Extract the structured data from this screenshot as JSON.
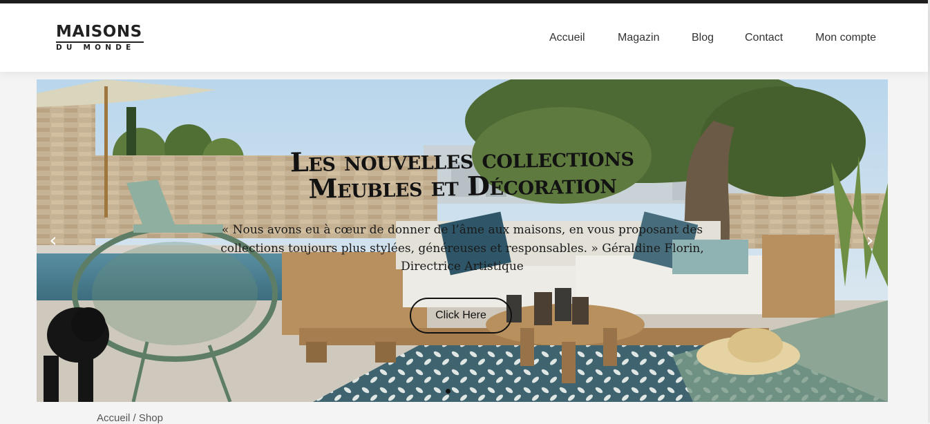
{
  "brand": {
    "name_top": "MAISONS",
    "name_bottom": "DU MONDE"
  },
  "nav": {
    "items": [
      {
        "label": "Accueil"
      },
      {
        "label": "Magazin"
      },
      {
        "label": "Blog"
      },
      {
        "label": "Contact"
      },
      {
        "label": "Mon compte"
      }
    ]
  },
  "hero": {
    "title_line1": "Les nouvelles collections",
    "title_line2": "Meubles et Décoration",
    "quote": "« Nous avons eu à cœur de donner de l’âme aux maisons, en vous proposant des collections toujours plus stylées, généreuses et responsables. » Géraldine Florin, Directrice Artistique",
    "button_label": "Click Here",
    "prev_icon": "chevron-left-icon",
    "next_icon": "chevron-right-icon",
    "slides_count": 3,
    "active_slide": 1
  },
  "breadcrumb": {
    "home": "Accueil",
    "separator": "/",
    "current": "Shop"
  },
  "colors": {
    "topbar": "#1f1f1f",
    "header_bg": "#ffffff",
    "text_dark": "#333333"
  }
}
